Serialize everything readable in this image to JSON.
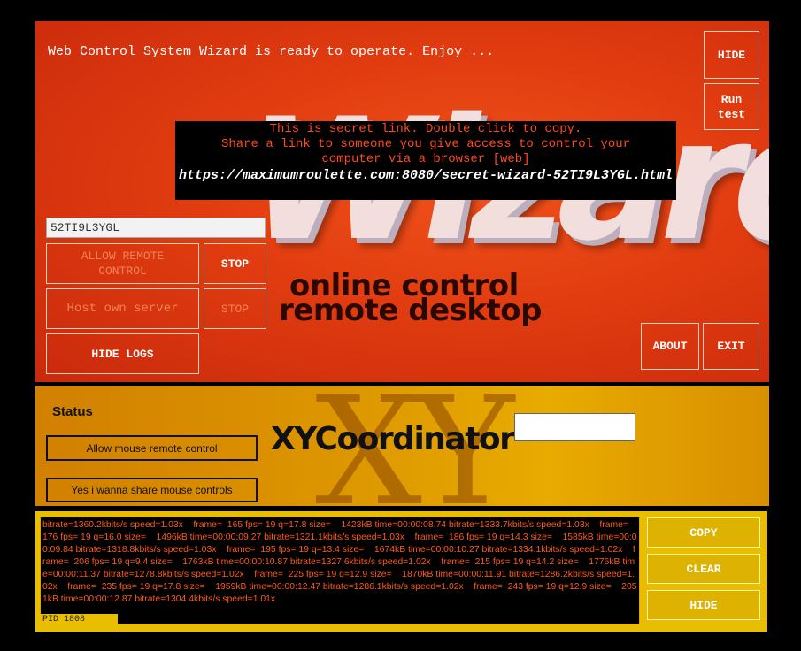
{
  "top": {
    "status_message": "Web Control System Wizard is ready to operate. Enjoy ...",
    "hide_button": "HIDE",
    "run_test_button": "Run test",
    "secret": {
      "line1": "This is secret link. Double click to copy.",
      "line2": "Share a link to someone you give access to control your",
      "line3": "computer via a browser [web]",
      "link": "https://maximumroulette.com:8080/secret-wizard-52TI9L3YGL.html"
    },
    "code_input_value": "52TI9L3YGL",
    "allow_remote_control": "ALLOW REMOTE CONTROL",
    "stop_button_1": "STOP",
    "host_own_server": "Host own server",
    "stop_button_2": "STOP",
    "hide_logs": "HIDE LOGS",
    "about_button": "ABOUT",
    "exit_button": "EXIT",
    "bg_wizard_text": "Wizard",
    "bg_sub_line1": "online control",
    "bg_sub_line2": "remote desktop"
  },
  "middle": {
    "status_title": "Status",
    "allow_mouse_button": "Allow mouse remote control",
    "share_mouse_button": "Yes i wanna share mouse controls",
    "logo_text": "XYCoordinator",
    "bg_text": "XY",
    "input_value": ""
  },
  "bottom": {
    "log_text": "bitrate=1360.2kbits/s speed=1.03x    frame=  165 fps= 19 q=17.8 size=    1423kB time=00:00:08.74 bitrate=1333.7kbits/s speed=1.03x    frame=  176 fps= 19 q=16.0 size=    1496kB time=00:00:09.27 bitrate=1321.1kbits/s speed=1.03x    frame=  186 fps= 19 q=14.3 size=    1585kB time=00:00:09.84 bitrate=1318.8kbits/s speed=1.03x    frame=  195 fps= 19 q=13.4 size=    1674kB time=00:00:10.27 bitrate=1334.1kbits/s speed=1.02x    frame=  206 fps= 19 q=9.4 size=    1763kB time=00:00:10.87 bitrate=1327.6kbits/s speed=1.02x    frame=  215 fps= 19 q=14.2 size=    1776kB time=00:00:11.37 bitrate=1278.8kbits/s speed=1.02x    frame=  225 fps= 19 q=12.9 size=    1870kB time=00:00:11.91 bitrate=1286.2kbits/s speed=1.02x    frame=  235 fps= 19 q=17.8 size=    1959kB time=00:00:12.47 bitrate=1286.1kbits/s speed=1.02x    frame=  243 fps= 19 q=12.9 size=    2051kB time=00:00:12.87 bitrate=1304.4kbits/s speed=1.01x",
    "pid": "PID 1808",
    "copy_button": "COPY",
    "clear_button": "CLEAR",
    "hide_button": "HIDE"
  }
}
